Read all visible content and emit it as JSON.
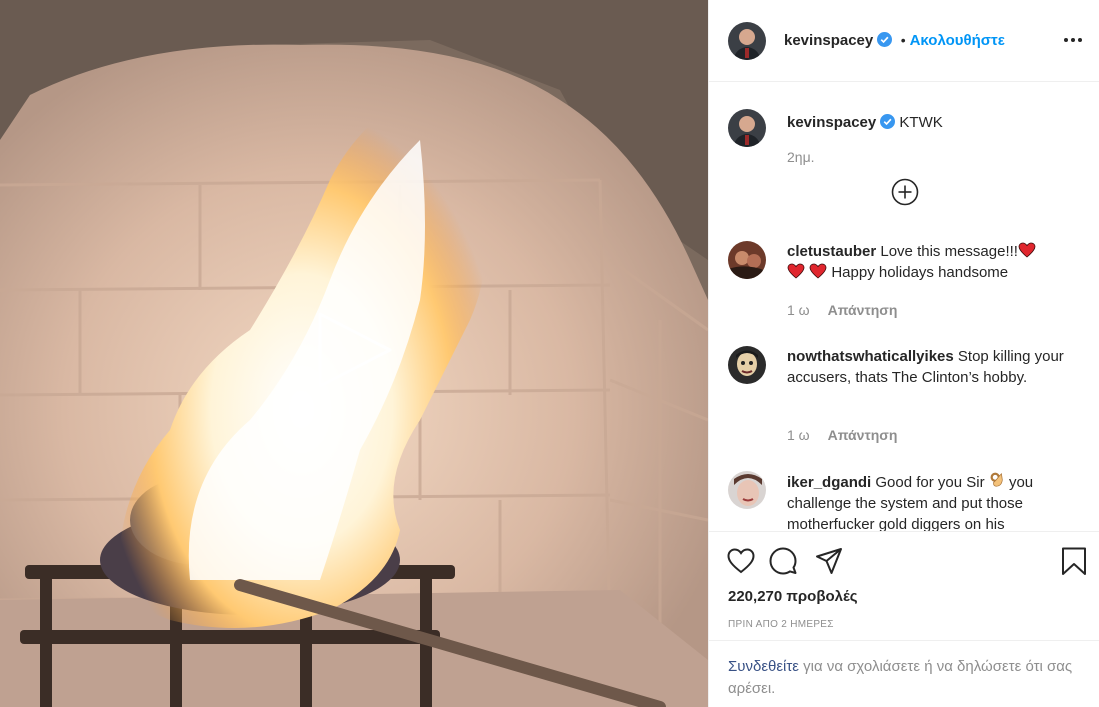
{
  "post": {
    "username": "kevinspacey",
    "follow_label": "Ακολουθήστε",
    "dot": "•",
    "caption": {
      "username": "kevinspacey",
      "text": "KTWK",
      "time": "2ημ."
    }
  },
  "comments": [
    {
      "username": "cletustauber",
      "text_part1": "Love this message!!!",
      "text_part2": "Happy holidays handsome",
      "time": "1 ω",
      "reply_label": "Απάντηση"
    },
    {
      "username": "nowthatswhaticallyikes",
      "text": "Stop killing your accusers, thats The Clinton’s hobby.",
      "time": "1 ω",
      "reply_label": "Απάντηση"
    },
    {
      "username": "iker_dgandi",
      "text_part1": "Good for you Sir",
      "text_part2": "you challenge the system and put those motherfucker gold diggers on his"
    }
  ],
  "footer": {
    "views": "220,270 προβολές",
    "time_ago": "ΠΡΙΝ ΑΠΟ 2 ΗΜΕΡΕΣ",
    "login_link": "Συνδεθείτε",
    "login_text": " για να σχολιάσετε ή να δηλώσετε ότι σας αρέσει."
  },
  "colors": {
    "link_blue": "#0095f6",
    "verified_blue": "#3897f0",
    "muted": "#8e8e8e",
    "login_link": "#385185",
    "heart_red": "#e0262e"
  },
  "icons": [
    "play-icon",
    "verified-icon",
    "more-icon",
    "load-more-comments-icon",
    "heart-icon",
    "comment-icon",
    "share-icon",
    "bookmark-icon",
    "red-heart-emoji",
    "ok-hand-emoji"
  ]
}
